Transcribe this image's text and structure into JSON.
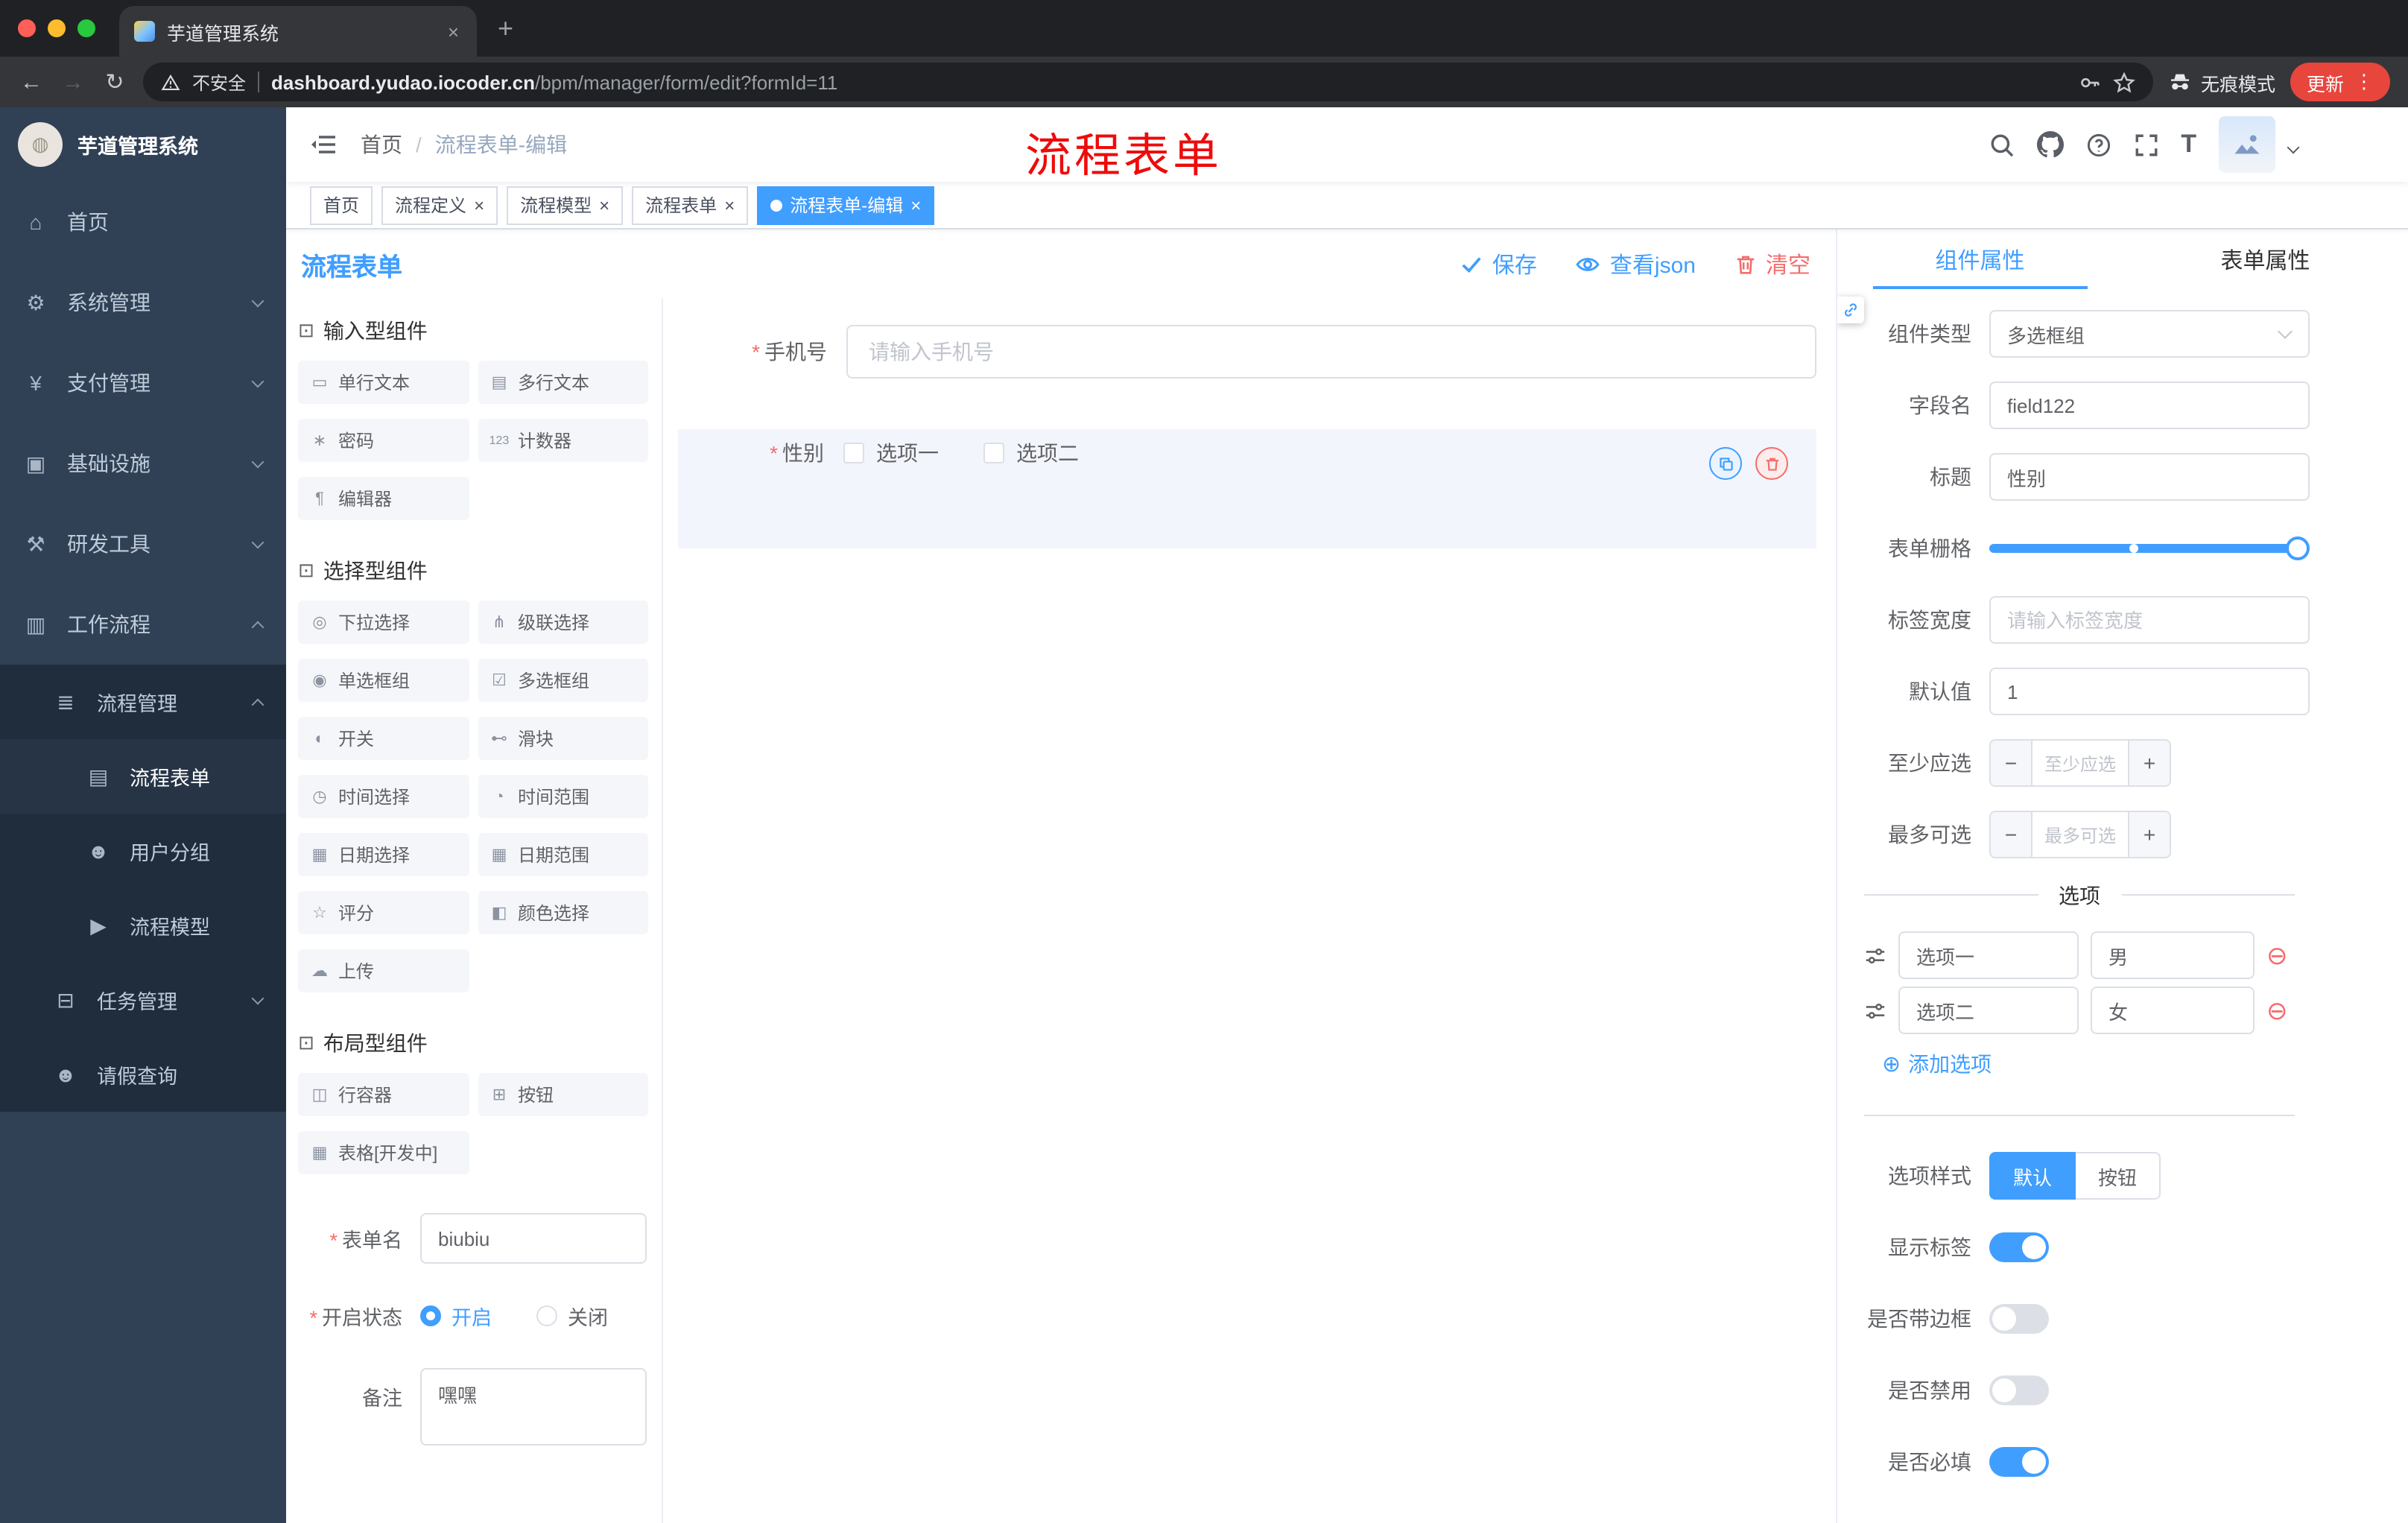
{
  "colors": {
    "accent": "#409EFF",
    "danger": "#F56C6C",
    "annotation_red": "#EE0B0B"
  },
  "browser": {
    "tab_title": "芋道管理系统",
    "security_label": "不安全",
    "url_domain": "dashboard.yudao.iocoder.cn",
    "url_path": "/bpm/manager/form/edit?formId=11",
    "incognito_label": "无痕模式",
    "update_label": "更新",
    "back_icon": "←",
    "forward_icon": "→",
    "reload_icon": "↻",
    "new_tab_icon": "+",
    "close_icon": "×",
    "menu_dots": "⋮"
  },
  "sidebar": {
    "logo_title": "芋道管理系统",
    "menu": [
      {
        "icon": "⌂",
        "label": "首页"
      },
      {
        "icon": "⚙",
        "label": "系统管理"
      },
      {
        "icon": "¥",
        "label": "支付管理"
      },
      {
        "icon": "▣",
        "label": "基础设施"
      },
      {
        "icon": "⚒",
        "label": "研发工具"
      },
      {
        "icon": "▥",
        "label": "工作流程"
      }
    ],
    "submenu": {
      "process_mgmt": {
        "icon": "≣",
        "label": "流程管理"
      },
      "process_children": [
        {
          "icon": "▤",
          "label": "流程表单",
          "active": true
        },
        {
          "icon": "☻",
          "label": "用户分组",
          "active": false
        },
        {
          "icon": "▶",
          "label": "流程模型",
          "active": false
        }
      ],
      "task_mgmt": {
        "icon": "⊟",
        "label": "任务管理"
      },
      "leave_query": {
        "icon": "☻",
        "label": "请假查询"
      }
    }
  },
  "navbar": {
    "breadcrumb": {
      "first": "首页",
      "separator": "/",
      "last": "流程表单-编辑"
    },
    "annotation": "流程表单",
    "size_icon_label": "T"
  },
  "tags": [
    {
      "label": "首页",
      "closable": false,
      "active": false
    },
    {
      "label": "流程定义",
      "closable": true,
      "active": false
    },
    {
      "label": "流程模型",
      "closable": true,
      "active": false
    },
    {
      "label": "流程表单",
      "closable": true,
      "active": false
    },
    {
      "label": "流程表单-编辑",
      "closable": true,
      "active": true
    }
  ],
  "designer": {
    "title": "流程表单",
    "save_label": "保存",
    "view_json_label": "查看json",
    "clear_label": "清空"
  },
  "palette": {
    "sections": [
      {
        "icon": "⊡",
        "title": "输入型组件",
        "items": [
          {
            "icon": "▭",
            "label": "单行文本"
          },
          {
            "icon": "▤",
            "label": "多行文本"
          },
          {
            "icon": "∗",
            "label": "密码"
          },
          {
            "icon": "123",
            "label": "计数器"
          },
          {
            "icon": "¶",
            "label": "编辑器"
          }
        ]
      },
      {
        "icon": "⊡",
        "title": "选择型组件",
        "items": [
          {
            "icon": "◎",
            "label": "下拉选择"
          },
          {
            "icon": "⋔",
            "label": "级联选择"
          },
          {
            "icon": "◉",
            "label": "单选框组"
          },
          {
            "icon": "☑",
            "label": "多选框组"
          },
          {
            "icon": "◐",
            "label": "开关"
          },
          {
            "icon": "⊷",
            "label": "滑块"
          },
          {
            "icon": "◷",
            "label": "时间选择"
          },
          {
            "icon": "◔",
            "label": "时间范围"
          },
          {
            "icon": "▦",
            "label": "日期选择"
          },
          {
            "icon": "▦",
            "label": "日期范围"
          },
          {
            "icon": "☆",
            "label": "评分"
          },
          {
            "icon": "◧",
            "label": "颜色选择"
          },
          {
            "icon": "☁",
            "label": "上传"
          }
        ]
      },
      {
        "icon": "⊡",
        "title": "布局型组件",
        "items": [
          {
            "icon": "◫",
            "label": "行容器"
          },
          {
            "icon": "⊞",
            "label": "按钮"
          },
          {
            "icon": "▦",
            "label": "表格[开发中]"
          }
        ]
      }
    ],
    "form": {
      "name_label": "表单名",
      "name_value": "biubiu",
      "status_label": "开启状态",
      "status_options": [
        {
          "label": "开启",
          "checked": true
        },
        {
          "label": "关闭",
          "checked": false
        }
      ],
      "remark_label": "备注",
      "remark_value": "嘿嘿"
    }
  },
  "canvas": {
    "phone": {
      "label": "手机号",
      "placeholder": "请输入手机号"
    },
    "gender": {
      "label": "性别",
      "options": [
        "选项一",
        "选项二"
      ]
    }
  },
  "props": {
    "tabs": [
      {
        "label": "组件属性",
        "active": true
      },
      {
        "label": "表单属性",
        "active": false
      }
    ],
    "type_label": "组件类型",
    "type_value": "多选框组",
    "field_label": "字段名",
    "field_value": "field122",
    "title_label": "标题",
    "title_value": "性别",
    "grid_label": "表单栅格",
    "width_label": "标签宽度",
    "width_placeholder": "请输入标签宽度",
    "default_label": "默认值",
    "default_value": "1",
    "min_label": "至少应选",
    "min_placeholder": "至少应选",
    "max_label": "最多可选",
    "max_placeholder": "最多可选",
    "minus_sign": "−",
    "plus_sign": "+",
    "options_divider": "选项",
    "options": [
      {
        "label": "选项一",
        "value": "男"
      },
      {
        "label": "选项二",
        "value": "女"
      }
    ],
    "remove_option_icon": "⊖",
    "add_option_icon": "⊕",
    "add_option_label": "添加选项",
    "style_label": "选项样式",
    "style_options": [
      {
        "label": "默认",
        "active": true
      },
      {
        "label": "按钮",
        "active": false
      }
    ],
    "switches": [
      {
        "label": "显示标签",
        "on": true
      },
      {
        "label": "是否带边框",
        "on": false
      },
      {
        "label": "是否禁用",
        "on": false
      },
      {
        "label": "是否必填",
        "on": true
      }
    ]
  }
}
